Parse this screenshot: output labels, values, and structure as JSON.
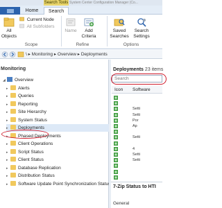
{
  "titlebar": {
    "context_tab": "Search Tools",
    "title_text": "System Center Configuration Manager (Co..."
  },
  "ribbon_tabs": {
    "home": "Home",
    "search": "Search"
  },
  "ribbon": {
    "all_objects": "All\nObjects",
    "current_node": "Current Node",
    "all_subfolders": "All Subfolders",
    "scope_label": "Scope",
    "name": "Name",
    "add_criteria": "Add\nCriteria",
    "refine_label": "Refine",
    "saved_searches": "Saved\nSearches",
    "search_settings": "Search\nSettings",
    "options_label": "Options",
    "add_criteria_arrow": "▾"
  },
  "address": {
    "crumbs": "\\  ▸  Monitoring  ▸  Overview  ▸  Deployments"
  },
  "left": {
    "title": "Monitoring",
    "items": [
      {
        "label": "Overview",
        "indent": 0
      },
      {
        "label": "Alerts",
        "indent": 1
      },
      {
        "label": "Queries",
        "indent": 1
      },
      {
        "label": "Reporting",
        "indent": 1
      },
      {
        "label": "Site Hierarchy",
        "indent": 1
      },
      {
        "label": "System Status",
        "indent": 1
      },
      {
        "label": "Deployments",
        "indent": 1
      },
      {
        "label": "Phased Deployments",
        "indent": 1
      },
      {
        "label": "Client Operations",
        "indent": 1
      },
      {
        "label": "Script Status",
        "indent": 1
      },
      {
        "label": "Client Status",
        "indent": 1
      },
      {
        "label": "Database Replication",
        "indent": 1
      },
      {
        "label": "Distribution Status",
        "indent": 1
      },
      {
        "label": "Software Update Point Synchronization Status",
        "indent": 1
      }
    ]
  },
  "right": {
    "title": "Deployments",
    "count": "23 items",
    "search_placeholder": "Search",
    "col_icon": "Icon",
    "col_software": "Software",
    "rows": [
      "",
      "",
      "Setti",
      "Setti",
      "Por",
      "Ap",
      "",
      "Setti",
      "",
      "4",
      "Setti",
      "Setti",
      "",
      "",
      ""
    ],
    "detail_title": "7-Zip Status to HTI",
    "detail_general": "General"
  },
  "colors": {
    "accent": "#2c63ad",
    "highlight": "#d01c2c",
    "folder": "#f1c95d"
  }
}
